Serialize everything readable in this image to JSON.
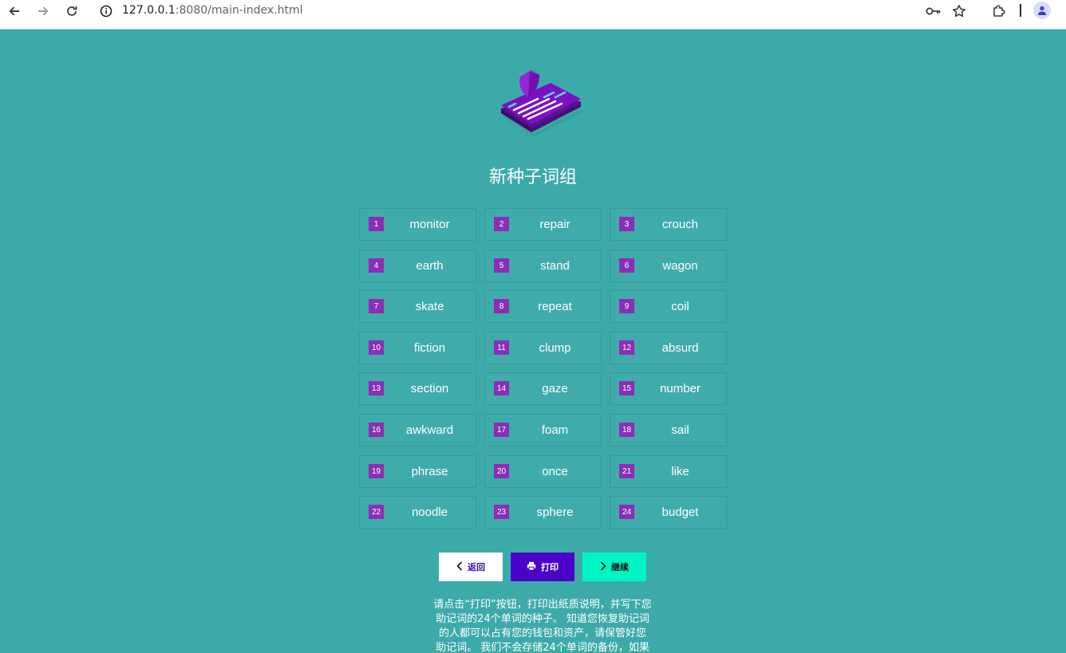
{
  "browser": {
    "url_host": "127.0.0.1",
    "url_rest": ":8080/main-index.html",
    "icons": [
      "back-arrow-icon",
      "forward-arrow-icon",
      "reload-icon",
      "site-info-icon",
      "key-icon",
      "star-icon",
      "extensions-icon",
      "profile-icon"
    ]
  },
  "page": {
    "title": "新种子词组",
    "hero_icon": "seed-phrase-card-icon"
  },
  "seed_words": [
    {
      "n": "1",
      "word": "monitor"
    },
    {
      "n": "2",
      "word": "repair"
    },
    {
      "n": "3",
      "word": "crouch"
    },
    {
      "n": "4",
      "word": "earth"
    },
    {
      "n": "5",
      "word": "stand"
    },
    {
      "n": "6",
      "word": "wagon"
    },
    {
      "n": "7",
      "word": "skate"
    },
    {
      "n": "8",
      "word": "repeat"
    },
    {
      "n": "9",
      "word": "coil"
    },
    {
      "n": "10",
      "word": "fiction"
    },
    {
      "n": "11",
      "word": "clump"
    },
    {
      "n": "12",
      "word": "absurd"
    },
    {
      "n": "13",
      "word": "section"
    },
    {
      "n": "14",
      "word": "gaze"
    },
    {
      "n": "15",
      "word": "number"
    },
    {
      "n": "16",
      "word": "awkward"
    },
    {
      "n": "17",
      "word": "foam"
    },
    {
      "n": "18",
      "word": "sail"
    },
    {
      "n": "19",
      "word": "phrase"
    },
    {
      "n": "20",
      "word": "once"
    },
    {
      "n": "21",
      "word": "like"
    },
    {
      "n": "22",
      "word": "noodle"
    },
    {
      "n": "23",
      "word": "sphere"
    },
    {
      "n": "24",
      "word": "budget"
    }
  ],
  "buttons": {
    "back": "返回",
    "print": "打印",
    "continue": "继续"
  },
  "notice_lines": [
    "请点击“打印”按钮，打印出纸质说明，并写下您",
    "助记词的24个单词的种子。 知道您恢复助记词",
    "的人都可以占有您的钱包和资产，请保管好您",
    "助记词。 我们不会存储24个单词的备份，如果"
  ],
  "colors": {
    "background": "#3daaaa",
    "number_badge": "#8a2fb5",
    "print_button": "#4b00c9",
    "continue_button": "#00f5c4"
  }
}
